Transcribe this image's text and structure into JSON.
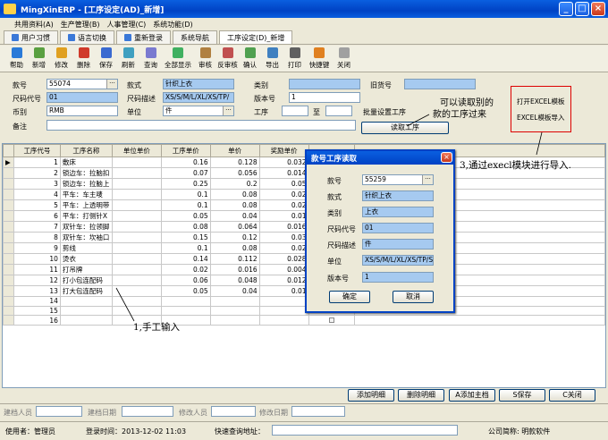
{
  "window": {
    "title": "MingXinERP - [工序设定(AD)_新增]",
    "min": "_",
    "max": "□",
    "close": "×"
  },
  "menubar": {
    "items": [
      "共用资料(A)",
      "生产管理(B)",
      "人事管理(C)",
      "系统功能(D)"
    ]
  },
  "tabs": [
    "用户习惯",
    "语言切换",
    "重新登录",
    "系统导航",
    "工序设定(D)_新增"
  ],
  "toolbar": {
    "items": [
      "帮助",
      "新增",
      "修改",
      "删除",
      "保存",
      "刷新",
      "查询",
      "全部显示",
      "审核",
      "反审核",
      "确认",
      "导出",
      "打印",
      "快捷键",
      "关闭"
    ],
    "icon_colors": [
      "#2a7ad8",
      "#5aa040",
      "#e0a020",
      "#d03a2a",
      "#3a6ad0",
      "#40a0c0",
      "#7a7ad0",
      "#40b060",
      "#b08040",
      "#c05050",
      "#50a050",
      "#4080c0",
      "#606060",
      "#e08020",
      "#a0a0a0"
    ]
  },
  "form": {
    "kuanhao_label": "款号",
    "kuanhao_value": "55074",
    "kuanshi_label": "款式",
    "kuanshi_value": "针织上衣",
    "leibie_label": "类别",
    "leibie_value": "",
    "jiuhuohao_label": "旧货号",
    "jiuhuohao_value": "",
    "chima_label": "尺码代号",
    "chima_value": "01",
    "chimamiaoshu_label": "尺码描述",
    "chimamiaoshu_value": "XS/S/M/L/XL/XS/TP/",
    "banben_label": "版本号",
    "banben_value": "1",
    "bibie_label": "币别",
    "bibie_value": "RMB",
    "danwei_label": "单位",
    "danwei_value": "件",
    "gongxu_label": "工序",
    "gongxu_from": "",
    "zhi_label": "至",
    "gongxu_to": "",
    "beizhu_label": "备注",
    "beizhu_value": "",
    "batch_label": "批量设置工序",
    "read_btn": "读取工序",
    "excel_template": "打开EXCEL模板",
    "excel_import": "EXCEL模板导入"
  },
  "grid": {
    "headers": [
      "工序代号",
      "工序名称",
      "单位单价",
      "工序单价",
      "单价",
      "奖励单价"
    ],
    "rows": [
      {
        "no": "1",
        "name": "敷床",
        "dwdj": "",
        "gxdj": "0.16",
        "dj": "0.128",
        "jl": "0.032"
      },
      {
        "no": "2",
        "name": "锁边车：拉脑扣",
        "dwdj": "",
        "gxdj": "0.07",
        "dj": "0.056",
        "jl": "0.014"
      },
      {
        "no": "3",
        "name": "锁边车：拉脑上",
        "dwdj": "",
        "gxdj": "0.25",
        "dj": "0.2",
        "jl": "0.05"
      },
      {
        "no": "4",
        "name": "平车：车主唛",
        "dwdj": "",
        "gxdj": "0.1",
        "dj": "0.08",
        "jl": "0.02"
      },
      {
        "no": "5",
        "name": "平车：上透明带",
        "dwdj": "",
        "gxdj": "0.1",
        "dj": "0.08",
        "jl": "0.02"
      },
      {
        "no": "6",
        "name": "平车：打侧针X",
        "dwdj": "",
        "gxdj": "0.05",
        "dj": "0.04",
        "jl": "0.01"
      },
      {
        "no": "7",
        "name": "双针车：拉领脚",
        "dwdj": "",
        "gxdj": "0.08",
        "dj": "0.064",
        "jl": "0.016"
      },
      {
        "no": "8",
        "name": "双针车：坎袖口",
        "dwdj": "",
        "gxdj": "0.15",
        "dj": "0.12",
        "jl": "0.03"
      },
      {
        "no": "9",
        "name": "剪线",
        "dwdj": "",
        "gxdj": "0.1",
        "dj": "0.08",
        "jl": "0.02"
      },
      {
        "no": "10",
        "name": "烫衣",
        "dwdj": "",
        "gxdj": "0.14",
        "dj": "0.112",
        "jl": "0.028"
      },
      {
        "no": "11",
        "name": "打吊牌",
        "dwdj": "",
        "gxdj": "0.02",
        "dj": "0.016",
        "jl": "0.004"
      },
      {
        "no": "12",
        "name": "打小包连配码",
        "dwdj": "",
        "gxdj": "0.06",
        "dj": "0.048",
        "jl": "0.012"
      },
      {
        "no": "13",
        "name": "打大包连配码",
        "dwdj": "",
        "gxdj": "0.05",
        "dj": "0.04",
        "jl": "0.01"
      },
      {
        "no": "14",
        "name": "",
        "dwdj": "",
        "gxdj": "",
        "dj": "",
        "jl": ""
      },
      {
        "no": "15",
        "name": "",
        "dwdj": "",
        "gxdj": "",
        "dj": "",
        "jl": ""
      },
      {
        "no": "16",
        "name": "",
        "dwdj": "",
        "gxdj": "",
        "dj": "",
        "jl": ""
      }
    ],
    "current_marker": "▶"
  },
  "dialog": {
    "title": "款号工序读取",
    "kuanhao_label": "款号",
    "kuanhao_value": "55259",
    "kuanshi_label": "款式",
    "kuanshi_value": "针织上衣",
    "leibie_label": "类别",
    "leibie_value": "上衣",
    "chima_label": "尺码代号",
    "chima_value": "01",
    "chimamiaoshu_label": "尺码描述",
    "chimamiaoshu_value": "件",
    "danwei_label": "单位",
    "danwei_value": "XS/S/M/L/XL/XS/TP/S",
    "banben_label": "版本号",
    "banben_value": "1",
    "ok": "确定",
    "cancel": "取消"
  },
  "annotations": {
    "a1": "1,手工输入",
    "a2_line1": "可以读取别的",
    "a2_line2": "款的工序过来",
    "a3": "3,通过execl模块进行导入."
  },
  "bottom_buttons": [
    "添加明细",
    "删除明细",
    "A添加主档",
    "S保存",
    "C关闭"
  ],
  "status_a": {
    "jd_person": "建档人员",
    "jd_date": "建档日期",
    "xg_person": "修改人员",
    "xg_date": "修改日期"
  },
  "status_b": {
    "user": "使用者：管理员",
    "login": "登录时间：2013-12-02 11:03",
    "quick": "快速查询地址：",
    "company": "公司简称: 明款软件"
  }
}
